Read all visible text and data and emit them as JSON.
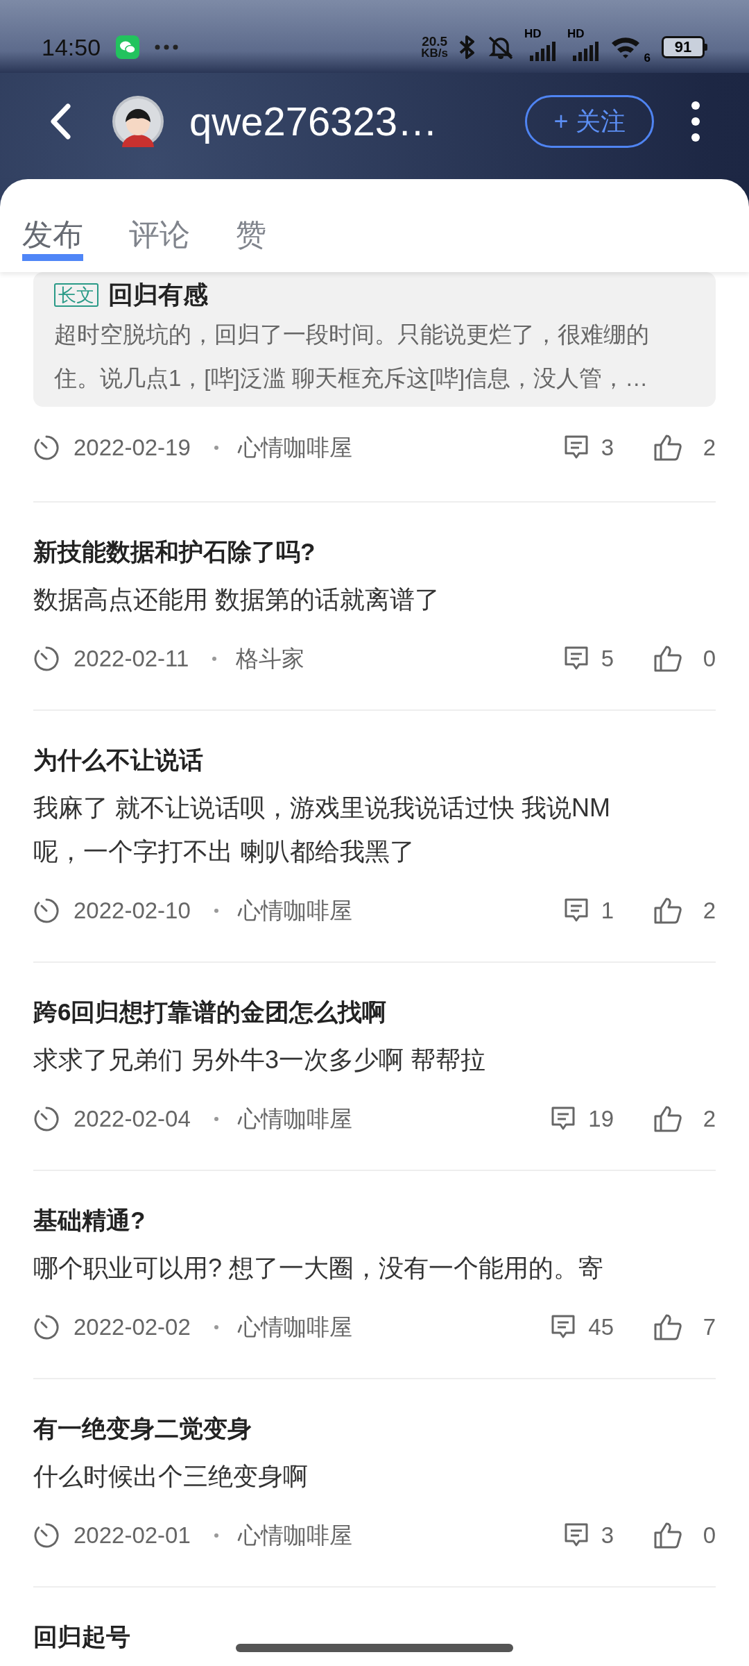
{
  "status_bar": {
    "time": "14:50",
    "net_speed": "20.5",
    "net_unit": "KB/s",
    "signal_labels": [
      "HD",
      "HD"
    ],
    "wifi_label": "6",
    "battery": "91"
  },
  "header": {
    "username": "qwe276323…",
    "follow_button": "+ 关注"
  },
  "tabs": [
    {
      "label": "发布",
      "selected": true
    },
    {
      "label": "评论",
      "selected": false
    },
    {
      "label": "赞",
      "selected": false
    }
  ],
  "posts": [
    {
      "kind": "long",
      "tag": "长文",
      "title": "回归有感",
      "body": [
        "超时空脱坑的，回归了一段时间。只能说更烂了，很难绷的",
        "住。说几点1，[哔]泛滥  聊天框充斥这[哔]信息，没人管，…"
      ],
      "date": "2022-02-19",
      "category": "心情咖啡屋",
      "comments": "3",
      "likes": "2"
    },
    {
      "kind": "normal",
      "title": "新技能数据和护石除了吗?",
      "body": [
        "数据高点还能用 数据第的话就离谱了"
      ],
      "date": "2022-02-11",
      "category": "格斗家",
      "comments": "5",
      "likes": "0"
    },
    {
      "kind": "normal",
      "title": "为什么不让说话",
      "body": [
        "我麻了 就不让说话呗，游戏里说我说话过快 我说NM",
        "呢，一个字打不出 喇叭都给我黑了"
      ],
      "date": "2022-02-10",
      "category": "心情咖啡屋",
      "comments": "1",
      "likes": "2"
    },
    {
      "kind": "normal",
      "title": "跨6回归想打靠谱的金团怎么找啊",
      "body": [
        "求求了兄弟们 另外牛3一次多少啊 帮帮拉"
      ],
      "date": "2022-02-04",
      "category": "心情咖啡屋",
      "comments": "19",
      "likes": "2"
    },
    {
      "kind": "normal",
      "title": "基础精通?",
      "body": [
        "哪个职业可以用? 想了一大圈，没有一个能用的。寄"
      ],
      "date": "2022-02-02",
      "category": "心情咖啡屋",
      "comments": "45",
      "likes": "7"
    },
    {
      "kind": "normal",
      "title": "有一绝变身二觉变身",
      "body": [
        "什么时候出个三绝变身啊"
      ],
      "date": "2022-02-01",
      "category": "心情咖啡屋",
      "comments": "3",
      "likes": "0"
    },
    {
      "kind": "title_only",
      "title": "回归起号"
    }
  ]
}
